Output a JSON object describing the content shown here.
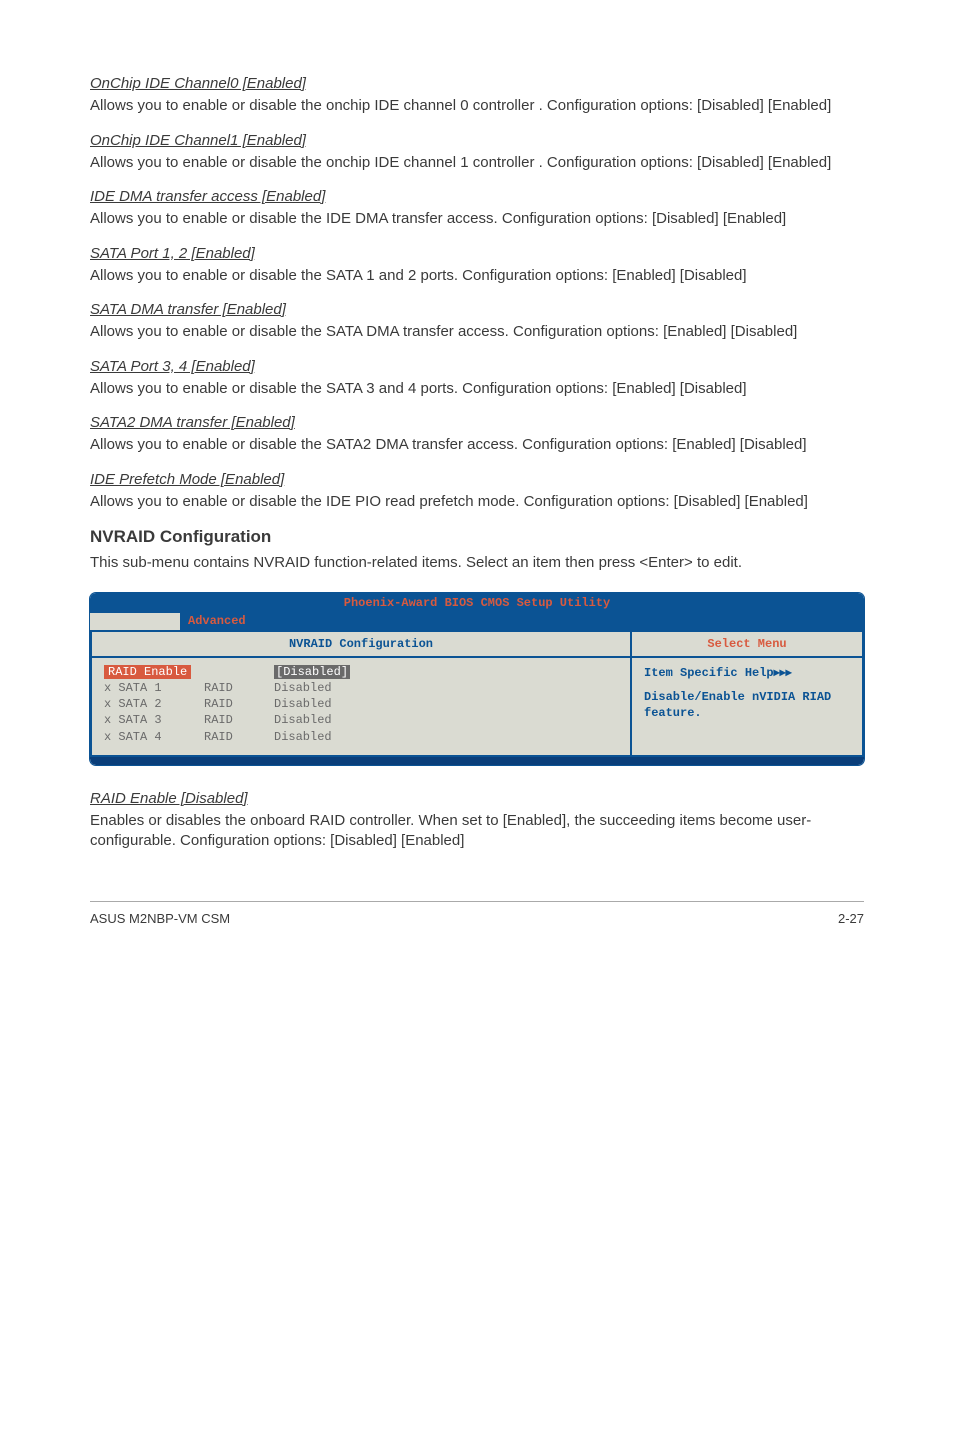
{
  "sections": {
    "onchip0": {
      "title": "OnChip IDE Channel0 [Enabled]",
      "body": "Allows you to enable or disable the onchip IDE channel 0 controller . Configuration options: [Disabled] [Enabled]"
    },
    "onchip1": {
      "title": "OnChip IDE Channel1 [Enabled]",
      "body": "Allows you to enable or disable the onchip IDE channel 1 controller . Configuration options: [Disabled] [Enabled]"
    },
    "idedma": {
      "title": "IDE DMA transfer access [Enabled]",
      "body": "Allows you to enable or disable the IDE DMA transfer access. Configuration options: [Disabled] [Enabled]"
    },
    "sataport12": {
      "title": "SATA Port 1, 2 [Enabled]",
      "body": "Allows you to enable or disable the SATA 1 and 2 ports. Configuration options: [Enabled] [Disabled]"
    },
    "satadma": {
      "title": "SATA DMA transfer [Enabled]",
      "body": "Allows you to enable or disable the SATA DMA transfer access. Configuration options: [Enabled] [Disabled]"
    },
    "sataport34": {
      "title": "SATA Port 3, 4 [Enabled]",
      "body": "Allows you to enable or disable the SATA 3 and 4 ports. Configuration options: [Enabled] [Disabled]"
    },
    "sata2dma": {
      "title": "SATA2 DMA transfer [Enabled]",
      "body": "Allows you to enable or disable the SATA2 DMA transfer access. Configuration options: [Enabled] [Disabled]"
    },
    "ideprefetch": {
      "title": "IDE Prefetch Mode [Enabled]",
      "body": "Allows you to enable or disable the IDE PIO read prefetch mode. Configuration options: [Disabled] [Enabled]"
    },
    "raidenable": {
      "title": "RAID Enable [Disabled]",
      "body": "Enables or disables the onboard RAID controller. When set to [Enabled], the succeeding items become user-configurable. Configuration options: [Disabled] [Enabled]"
    }
  },
  "heading": "NVRAID Configuration",
  "intro": "This sub-menu contains NVRAID function-related items. Select an item then press <Enter> to edit.",
  "bios": {
    "banner": "Phoenix-Award BIOS CMOS Setup Utility",
    "tab": "Advanced",
    "left_title": "NVRAID Configuration",
    "right_title": "Select Menu",
    "help_title": "Item Specific Help",
    "help_body": "Disable/Enable nVIDIA RIAD feature.",
    "selected_label": "RAID Enable",
    "selected_value": "Disabled",
    "rows": [
      {
        "c1": "x SATA 1",
        "c2": "RAID",
        "c3": "Disabled"
      },
      {
        "c1": "x SATA 2",
        "c2": "RAID",
        "c3": "Disabled"
      },
      {
        "c1": "x SATA 3",
        "c2": "RAID",
        "c3": "Disabled"
      },
      {
        "c1": "x SATA 4",
        "c2": "RAID",
        "c3": "Disabled"
      }
    ]
  },
  "footer": {
    "left": "ASUS M2NBP-VM CSM",
    "right": "2-27"
  }
}
